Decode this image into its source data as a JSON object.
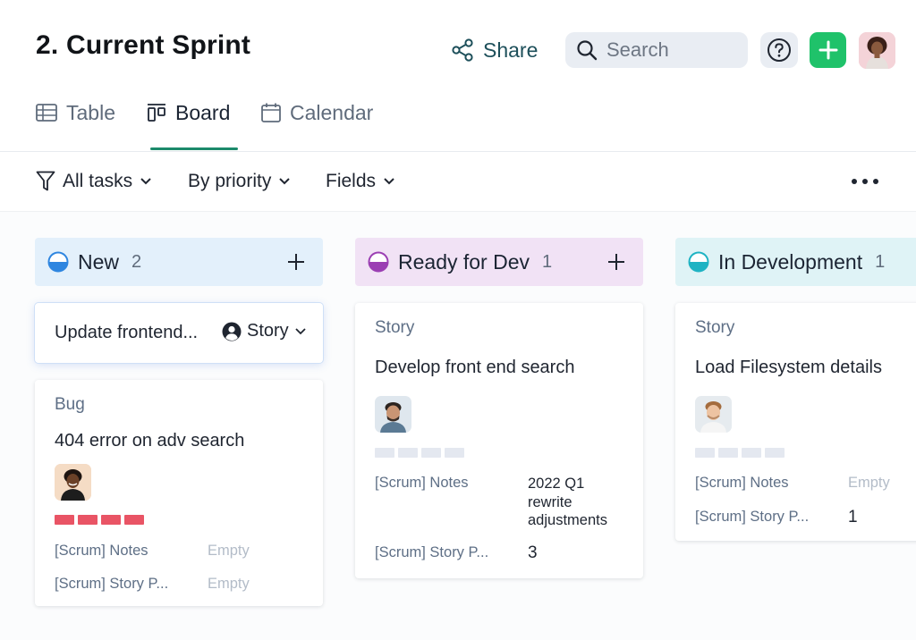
{
  "header": {
    "title": "2. Current Sprint",
    "share_label": "Share",
    "search_placeholder": "Search"
  },
  "tabs": [
    {
      "label": "Table",
      "icon": "table-icon"
    },
    {
      "label": "Board",
      "icon": "board-icon",
      "active": true
    },
    {
      "label": "Calendar",
      "icon": "calendar-icon"
    }
  ],
  "toolbar": {
    "filter_label": "All tasks",
    "group_label": "By priority",
    "fields_label": "Fields"
  },
  "colors": {
    "accent_green": "#1fc26a",
    "tab_underline": "#1c8a6b",
    "priority_red": "#e95465",
    "priority_empty": "#e4e8f0",
    "new_status": "#2f86e0",
    "ready_status": "#9b3fb3",
    "dev_status": "#1fb3c3"
  },
  "columns": [
    {
      "title": "New",
      "count": "2",
      "quick_add": {
        "text": "Update frontend...",
        "type_label": "Story"
      },
      "cards": [
        {
          "type": "Bug",
          "title": "404 error on adv search",
          "priority_level": 4,
          "fields": [
            {
              "label": "[Scrum] Notes",
              "value": "Empty"
            },
            {
              "label": "[Scrum] Story P...",
              "value": "Empty"
            }
          ]
        }
      ]
    },
    {
      "title": "Ready for Dev",
      "count": "1",
      "cards": [
        {
          "type": "Story",
          "title": "Develop front end search",
          "priority_level": 0,
          "fields": [
            {
              "label": "[Scrum] Notes",
              "value_lines": [
                "2022 Q1",
                "rewrite",
                "adjustments"
              ]
            },
            {
              "label": "[Scrum] Story P...",
              "value": "3"
            }
          ]
        }
      ]
    },
    {
      "title": "In Development",
      "count": "1",
      "cards": [
        {
          "type": "Story",
          "title": "Load Filesystem details",
          "priority_level": 0,
          "fields": [
            {
              "label": "[Scrum] Notes",
              "value": "Empty"
            },
            {
              "label": "[Scrum] Story P...",
              "value": "1"
            }
          ]
        }
      ]
    }
  ]
}
